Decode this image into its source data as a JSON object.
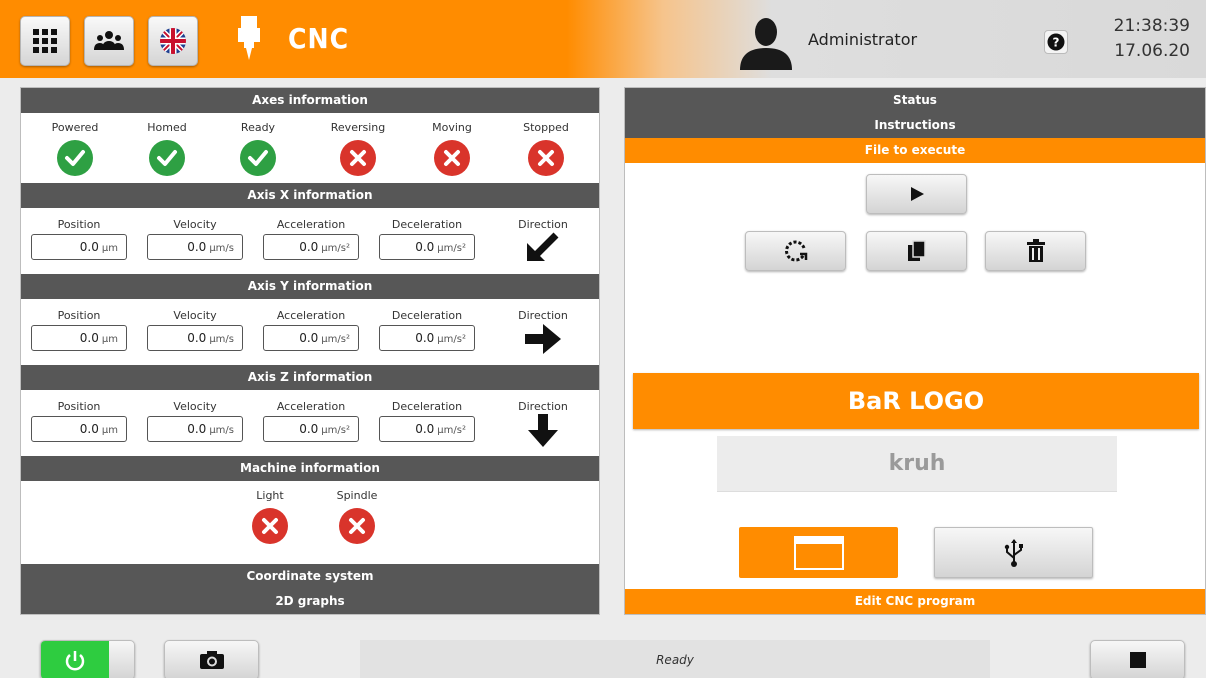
{
  "header": {
    "title": "CNC",
    "user": "Administrator",
    "time": "21:38:39",
    "date": "17.06.20",
    "icons": [
      "grid-icon",
      "users-icon",
      "uk-flag-icon",
      "spindle-icon",
      "user-avatar-icon",
      "help-icon"
    ]
  },
  "left": {
    "axes_info": {
      "title": "Axes information",
      "items": [
        {
          "label": "Powered",
          "state": "ok"
        },
        {
          "label": "Homed",
          "state": "ok"
        },
        {
          "label": "Ready",
          "state": "ok"
        },
        {
          "label": "Reversing",
          "state": "bad"
        },
        {
          "label": "Moving",
          "state": "bad"
        },
        {
          "label": "Stopped",
          "state": "bad"
        }
      ]
    },
    "labels": {
      "position": "Position",
      "velocity": "Velocity",
      "acceleration": "Acceleration",
      "deceleration": "Deceleration",
      "direction": "Direction"
    },
    "axes": [
      {
        "title": "Axis X information",
        "position": "0.0",
        "position_unit": "µm",
        "velocity": "0.0",
        "velocity_unit": "µm/s",
        "acceleration": "0.0",
        "acceleration_unit": "µm/s²",
        "deceleration": "0.0",
        "deceleration_unit": "µm/s²",
        "direction_icon": "arrow-down-left-icon"
      },
      {
        "title": "Axis Y information",
        "position": "0.0",
        "position_unit": "µm",
        "velocity": "0.0",
        "velocity_unit": "µm/s",
        "acceleration": "0.0",
        "acceleration_unit": "µm/s²",
        "deceleration": "0.0",
        "deceleration_unit": "µm/s²",
        "direction_icon": "arrow-right-icon"
      },
      {
        "title": "Axis Z information",
        "position": "0.0",
        "position_unit": "µm",
        "velocity": "0.0",
        "velocity_unit": "µm/s",
        "acceleration": "0.0",
        "acceleration_unit": "µm/s²",
        "deceleration": "0.0",
        "deceleration_unit": "µm/s²",
        "direction_icon": "arrow-down-icon"
      }
    ],
    "machine_info": {
      "title": "Machine information",
      "items": [
        {
          "label": "Light",
          "state": "bad"
        },
        {
          "label": "Spindle",
          "state": "bad"
        }
      ]
    },
    "coordinate_system": "Coordinate system",
    "graphs": "2D graphs"
  },
  "right": {
    "status": "Status",
    "instructions": "Instructions",
    "file_to_execute": "File to execute",
    "program_logo": "BaR LOGO",
    "file_name": "kruh",
    "edit_program": "Edit CNC program",
    "icons": [
      "play-icon",
      "reload-icon",
      "copy-icon",
      "trash-icon",
      "window-icon",
      "usb-icon"
    ]
  },
  "footer": {
    "status_text": "Ready",
    "icons": [
      "power-icon",
      "camera-icon",
      "stop-icon"
    ]
  },
  "colors": {
    "accent": "#ff8c00",
    "bar": "#575757",
    "ok": "#2ea043",
    "bad": "#d9342b",
    "power": "#2ecc40"
  }
}
